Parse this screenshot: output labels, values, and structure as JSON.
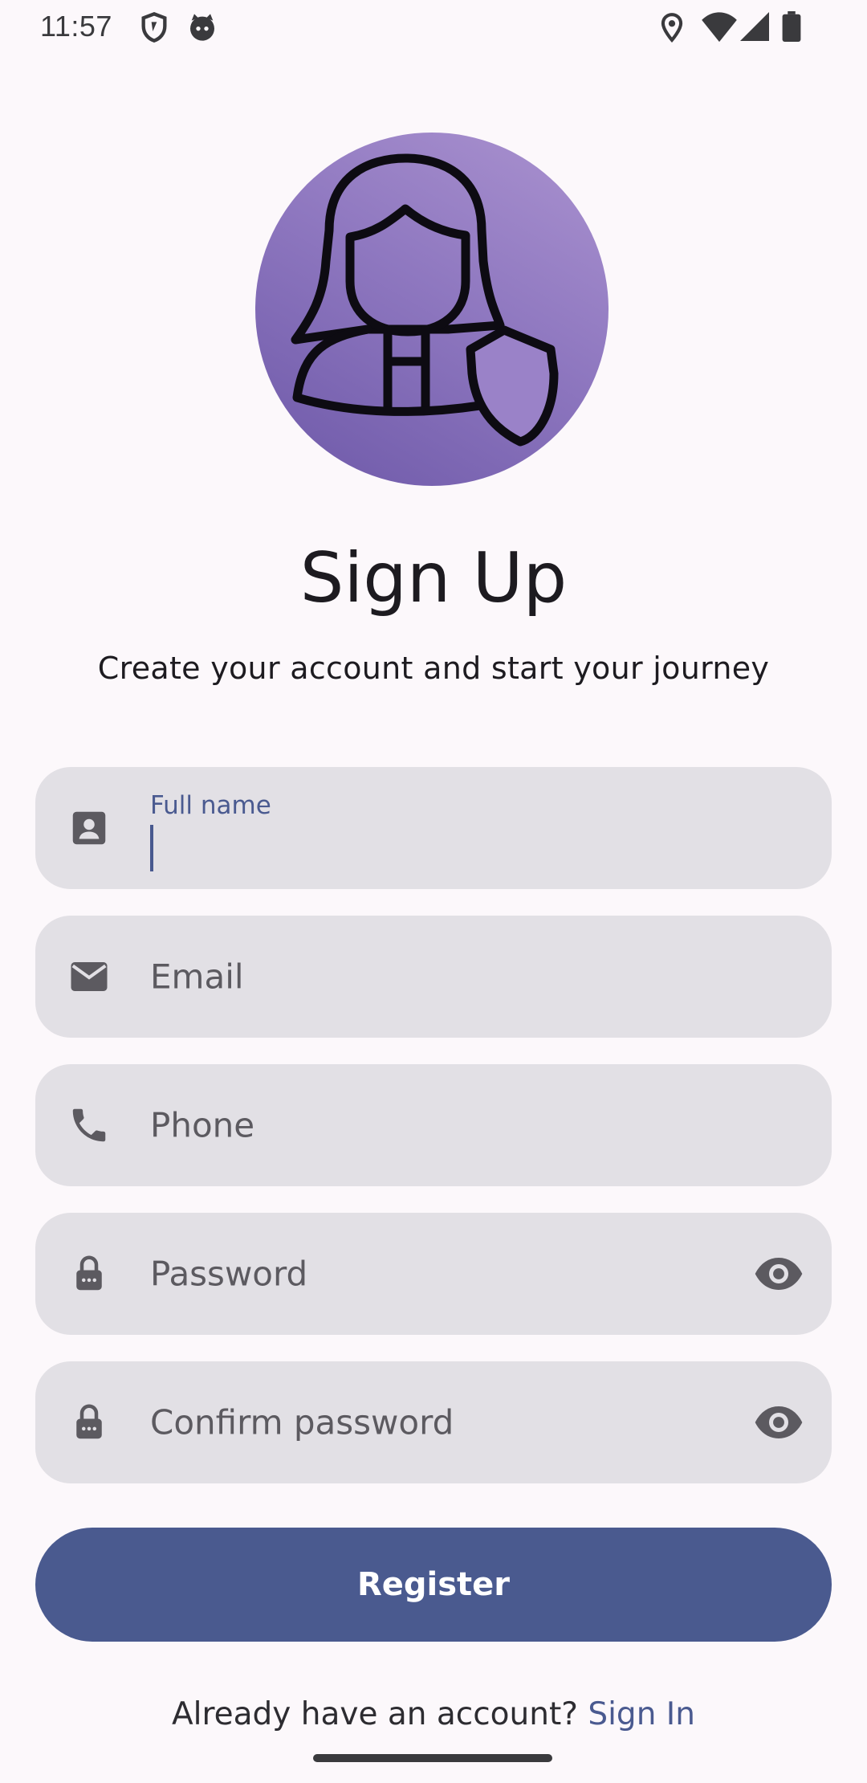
{
  "status_bar": {
    "time": "11:57",
    "icons_left": [
      "shield-icon",
      "cat-face-icon"
    ],
    "icons_right": [
      "location-icon",
      "wifi-icon",
      "signal-icon",
      "battery-icon"
    ]
  },
  "header": {
    "avatar_icon": "person-shield-icon",
    "title": "Sign Up",
    "subtitle": "Create your account and start your journey"
  },
  "form": {
    "full_name": {
      "label": "Full name",
      "value": "",
      "icon": "contact-card-icon",
      "focused": true
    },
    "email": {
      "placeholder": "Email",
      "icon": "envelope-icon"
    },
    "phone": {
      "placeholder": "Phone",
      "icon": "phone-icon"
    },
    "password": {
      "placeholder": "Password",
      "icon": "lock-icon",
      "toggle_icon": "eye-icon"
    },
    "confirm_password": {
      "placeholder": "Confirm password",
      "icon": "lock-icon",
      "toggle_icon": "eye-icon"
    },
    "register_label": "Register"
  },
  "footer": {
    "prompt": "Already have an account? ",
    "link": "Sign In"
  },
  "colors": {
    "background": "#fcf8fb",
    "field": "#e2e0e5",
    "primary": "#4a5a8f",
    "avatar_gradient": [
      "#ab93d0",
      "#6d58a8"
    ]
  }
}
